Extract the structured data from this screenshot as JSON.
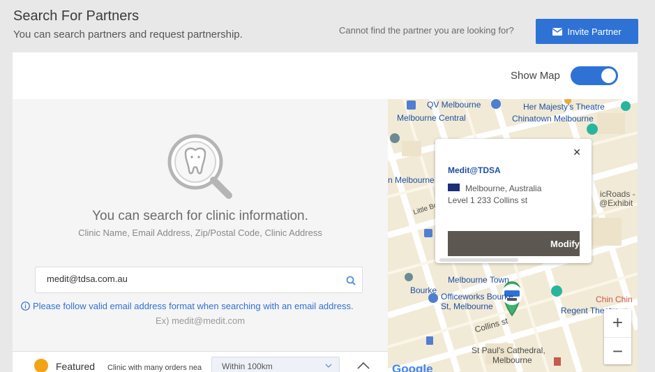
{
  "header": {
    "title": "Search For Partners",
    "subtitle": "You can search partners and request partnership.",
    "cannot_find": "Cannot find the partner you are looking for?",
    "invite_label": "Invite Partner"
  },
  "controls": {
    "show_map_label": "Show Map",
    "show_map_on": true
  },
  "empty_state": {
    "title": "You can search for clinic information.",
    "subtitle": "Clinic Name, Email Address, Zip/Postal Code, Clinic Address"
  },
  "search": {
    "value": "medit@tdsa.com.au",
    "placeholder": ""
  },
  "warning": {
    "text": "Please follow valid email address format when searching with an email address.",
    "example": "Ex) medit@medit.com"
  },
  "featured": {
    "label": "Featured",
    "description": "Clinic with many orders nea",
    "range_value": "Within 100km"
  },
  "map": {
    "labels": {
      "qv": "QV Melbourne",
      "central": "Melbourne Central",
      "majesty": "Her Majesty's Theatre",
      "chinatown": "Chinatown Melbourne",
      "melbourne_left": "n Melbourne",
      "little_bourke": "Little Bo",
      "bourke": "Bourke",
      "officeworks_1": "Officeworks Bourke",
      "officeworks_2": "St, Melbourne",
      "town": "Melbourne Town",
      "regent": "Regent Theatre",
      "chin": "Chin Chin",
      "collins": "Collins st",
      "cathedral_1": "St Paul's Cathedral,",
      "cathedral_2": "Melbourne",
      "icroads": "icRoads - H",
      "exhibit": "@Exhibit",
      "google": "Google"
    },
    "popup": {
      "name": "Medit@TDSA",
      "city": "Melbourne, Australia",
      "address": "Level 1 233 Collins st",
      "modify_label": "Modify",
      "close": "✕"
    },
    "zoom_in": "+",
    "zoom_out": "−"
  },
  "colors": {
    "accent": "#2f72d6",
    "popup_button": "#5d5751",
    "marker": "#3cb371"
  }
}
